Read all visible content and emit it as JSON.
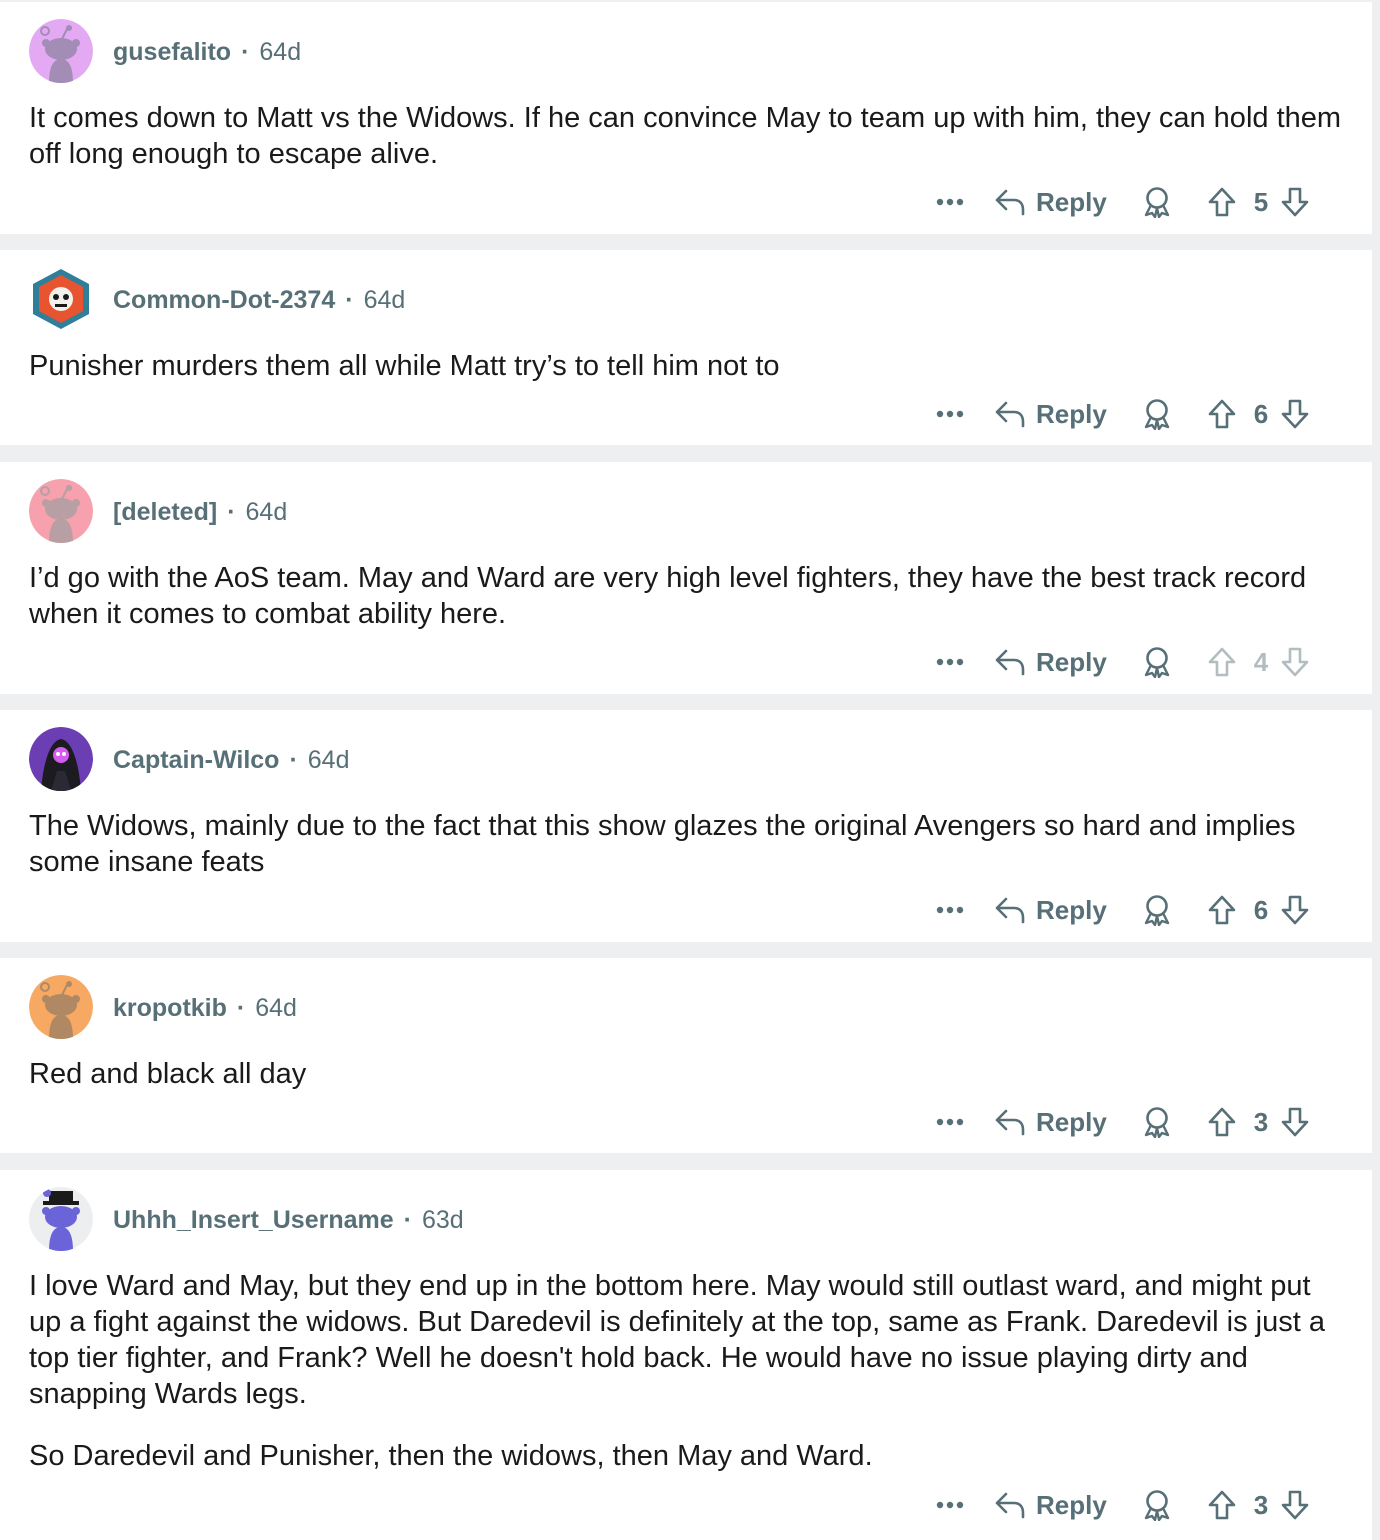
{
  "comments": [
    {
      "user": "gusefalito",
      "time": "64d",
      "avatar": {
        "kind": "snoo",
        "bg": "#e3aaf3",
        "fg": "#a38cb6",
        "icon": "snoo-avatar-icon"
      },
      "text": [
        "It comes down to Matt vs the Widows. If he can convince May to team up with him, they can hold them off long enough to escape alive."
      ],
      "more_label": "•••",
      "reply_label": "Reply",
      "score": "5",
      "vote_faded": false
    },
    {
      "user": "Common-Dot-2374",
      "time": "64d",
      "avatar": {
        "kind": "hex",
        "bg": "#2f7f9a",
        "fg": "#e8542f",
        "icon": "hexagon-avatar-icon"
      },
      "text": [
        "Punisher murders them all while Matt try’s to tell him not to"
      ],
      "more_label": "•••",
      "reply_label": "Reply",
      "score": "6",
      "vote_faded": false
    },
    {
      "user": "[deleted]",
      "time": "64d",
      "avatar": {
        "kind": "snoo",
        "bg": "#f6a1ad",
        "fg": "#b89fa3",
        "icon": "snoo-avatar-icon"
      },
      "text": [
        "I’d go with the AoS team. May and Ward are very high level fighters, they have the best track record when it comes to combat ability here."
      ],
      "more_label": "•••",
      "reply_label": "Reply",
      "score": "4",
      "vote_faded": true
    },
    {
      "user": "Captain-Wilco",
      "time": "64d",
      "avatar": {
        "kind": "hooded",
        "bg": "#6b3fb3",
        "fg": "#1d1b22",
        "icon": "hooded-figure-avatar-icon"
      },
      "text": [
        "The Widows, mainly due to the fact that this show glazes the original Avengers so hard and implies some insane feats"
      ],
      "more_label": "•••",
      "reply_label": "Reply",
      "score": "6",
      "vote_faded": false
    },
    {
      "user": "kropotkib",
      "time": "64d",
      "avatar": {
        "kind": "snoo",
        "bg": "#f7a964",
        "fg": "#b08964",
        "icon": "snoo-avatar-icon"
      },
      "text": [
        "Red and black all day"
      ],
      "more_label": "•••",
      "reply_label": "Reply",
      "score": "3",
      "vote_faded": false
    },
    {
      "user": "Uhhh_Insert_Username",
      "time": "63d",
      "avatar": {
        "kind": "snoo-hat",
        "bg": "#eceef0",
        "fg": "#6b64d8",
        "icon": "snoo-hat-avatar-icon"
      },
      "text": [
        "I love Ward and May, but they end up in the bottom here. May would still outlast ward, and might put up a fight against the widows. But Daredevil is definitely at the top, same as Frank. Daredevil is just a top tier fighter, and Frank? Well he doesn't hold back. He would have no issue playing dirty and snapping Wards legs.",
        "So Daredevil and Punisher, then the widows, then May and Ward."
      ],
      "more_label": "•••",
      "reply_label": "Reply",
      "score": "3",
      "vote_faded": false
    }
  ]
}
